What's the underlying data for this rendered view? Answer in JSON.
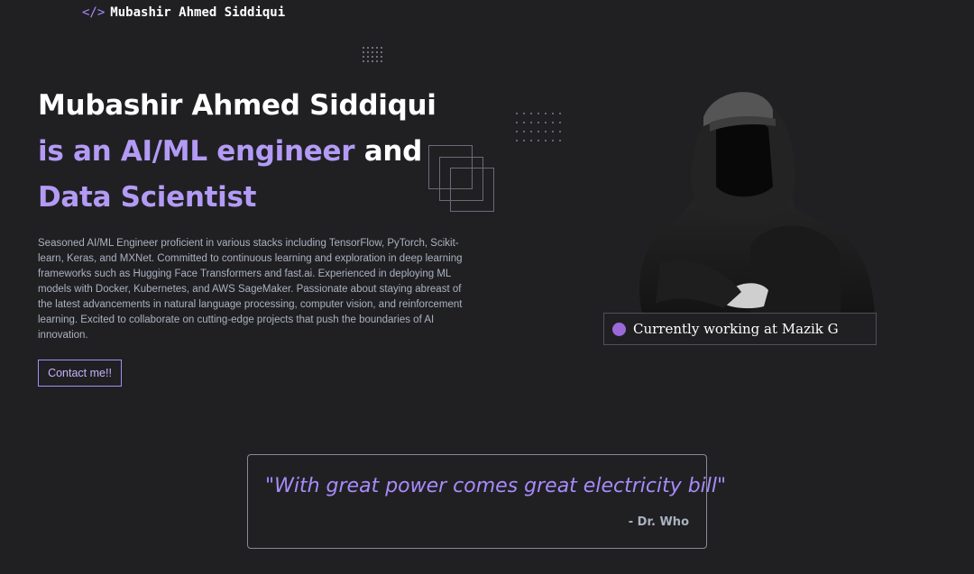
{
  "header": {
    "logo_icon": "</>",
    "logo_text": "Mubashir Ahmed Siddiqui"
  },
  "hero": {
    "line1": "Mubashir Ahmed Siddiqui",
    "line2_highlight": "is an AI/ML engineer",
    "line2_rest": " and",
    "line3_highlight": "Data Scientist",
    "description": "Seasoned AI/ML Engineer proficient in various stacks including TensorFlow, PyTorch, Scikit-learn, Keras, and MXNet. Committed to continuous learning and exploration in deep learning frameworks such as Hugging Face Transformers and fast.ai. Experienced in deploying ML models with Docker, Kubernetes, and AWS SageMaker. Passionate about staying abreast of the latest advancements in natural language processing, computer vision, and reinforcement learning. Excited to collaborate on cutting-edge projects that push the boundaries of AI innovation.",
    "contact_label": "Contact me!!"
  },
  "status": {
    "text": "Currently working at Mazik G"
  },
  "quote": {
    "text": "\"With great power comes great electricity bill\"",
    "author": "- Dr. Who"
  },
  "colors": {
    "background": "#202023",
    "accent": "#a78bfa",
    "text_muted": "#abb2bf"
  }
}
